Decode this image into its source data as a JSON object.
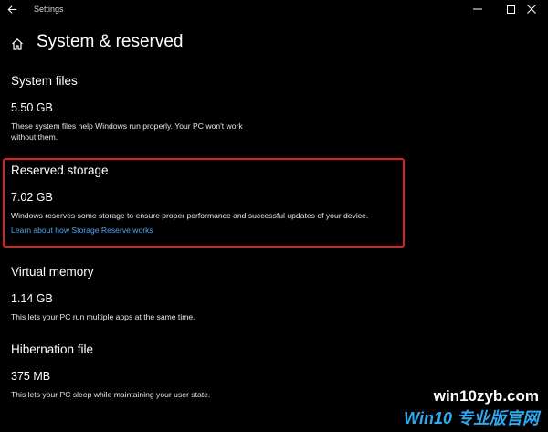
{
  "titlebar": {
    "app_title": "Settings",
    "back_icon": "arrow-left-icon",
    "minimize_icon": "minimize-icon",
    "maximize_icon": "maximize-icon",
    "close_icon": "close-icon"
  },
  "header": {
    "home_icon": "home-icon",
    "title": "System & reserved"
  },
  "sections": [
    {
      "heading": "System files",
      "size": "5.50 GB",
      "description_lines": [
        "These system files help Windows run properly. Your PC won't work",
        "without them."
      ]
    },
    {
      "heading": "Reserved storage",
      "size": "7.02 GB",
      "description_lines": [
        "Windows reserves some storage to ensure proper performance and successful updates of your device."
      ],
      "link": "Learn about how Storage Reserve works",
      "highlighted": true
    },
    {
      "heading": "Virtual memory",
      "size": "1.14 GB",
      "description_lines": [
        "This lets your PC run multiple apps at the same time."
      ]
    },
    {
      "heading": "Hibernation file",
      "size": "375 MB",
      "description_lines": [
        "This lets your PC sleep while maintaining your user state."
      ]
    }
  ],
  "watermark": {
    "url": "win10zyb.com",
    "brand": "Win10 专业版官网"
  },
  "colors": {
    "background": "#000000",
    "text": "#ffffff",
    "link": "#4aa6f7",
    "highlight_border": "#e02020",
    "watermark_brand": "#2fa8f0"
  }
}
